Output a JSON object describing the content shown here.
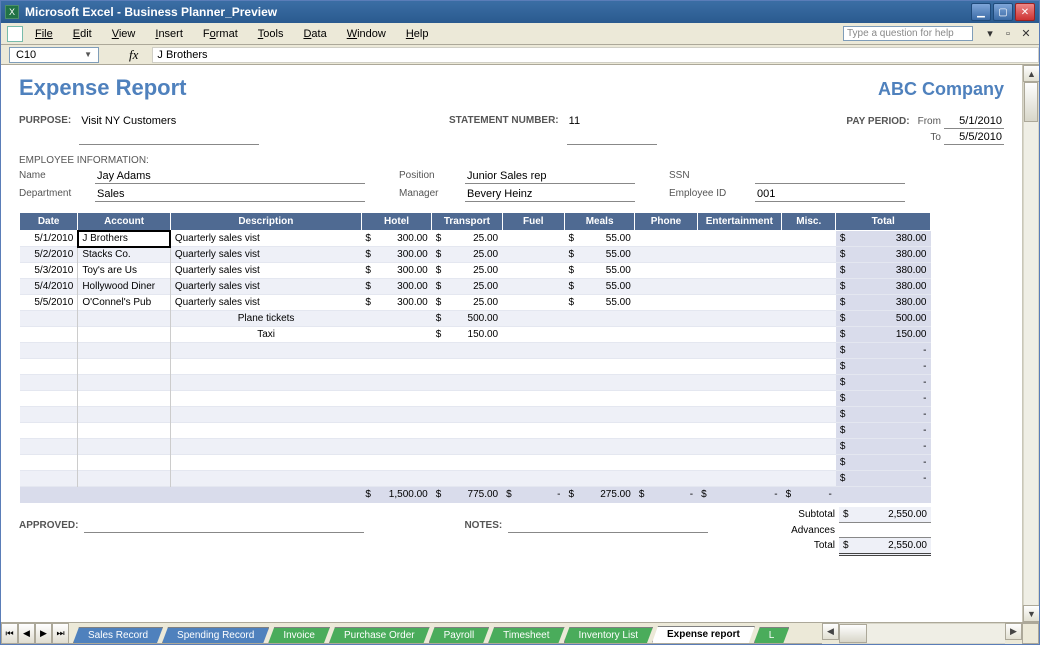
{
  "window": {
    "title": "Microsoft Excel - Business Planner_Preview",
    "help_placeholder": "Type a question for help"
  },
  "menu": {
    "file": "File",
    "edit": "Edit",
    "view": "View",
    "insert": "Insert",
    "format": "Format",
    "tools": "Tools",
    "data": "Data",
    "window": "Window",
    "help": "Help"
  },
  "formula_bar": {
    "cell": "C10",
    "value": "J Brothers"
  },
  "doc": {
    "title": "Expense Report",
    "company": "ABC Company",
    "purpose_label": "PURPOSE:",
    "purpose": "Visit NY Customers",
    "statement_label": "STATEMENT NUMBER:",
    "statement": "11",
    "pay_period_label": "PAY PERIOD:",
    "from_label": "From",
    "from": "5/1/2010",
    "to_label": "To",
    "to": "5/5/2010",
    "emp_info_label": "EMPLOYEE INFORMATION:",
    "name_label": "Name",
    "name": "Jay Adams",
    "department_label": "Department",
    "department": "Sales",
    "position_label": "Position",
    "position": "Junior Sales rep",
    "manager_label": "Manager",
    "manager": "Bevery Heinz",
    "ssn_label": "SSN",
    "ssn": "",
    "empid_label": "Employee ID",
    "empid": "001",
    "approved_label": "APPROVED:",
    "notes_label": "NOTES:"
  },
  "table": {
    "headers": [
      "Date",
      "Account",
      "Description",
      "Hotel",
      "Transport",
      "Fuel",
      "Meals",
      "Phone",
      "Entertainment",
      "Misc.",
      "Total"
    ],
    "rows": [
      {
        "date": "5/1/2010",
        "account": "J Brothers",
        "desc": "Quarterly sales vist",
        "hotel": "300.00",
        "transport": "25.00",
        "fuel": "",
        "meals": "55.00",
        "phone": "",
        "ent": "",
        "misc": "",
        "total": "380.00",
        "selected": true
      },
      {
        "date": "5/2/2010",
        "account": "Stacks Co.",
        "desc": "Quarterly sales vist",
        "hotel": "300.00",
        "transport": "25.00",
        "fuel": "",
        "meals": "55.00",
        "phone": "",
        "ent": "",
        "misc": "",
        "total": "380.00"
      },
      {
        "date": "5/3/2010",
        "account": "Toy's are Us",
        "desc": "Quarterly sales vist",
        "hotel": "300.00",
        "transport": "25.00",
        "fuel": "",
        "meals": "55.00",
        "phone": "",
        "ent": "",
        "misc": "",
        "total": "380.00"
      },
      {
        "date": "5/4/2010",
        "account": "Hollywood Diner",
        "desc": "Quarterly sales vist",
        "hotel": "300.00",
        "transport": "25.00",
        "fuel": "",
        "meals": "55.00",
        "phone": "",
        "ent": "",
        "misc": "",
        "total": "380.00"
      },
      {
        "date": "5/5/2010",
        "account": "O'Connel's Pub",
        "desc": "Quarterly sales vist",
        "hotel": "300.00",
        "transport": "25.00",
        "fuel": "",
        "meals": "55.00",
        "phone": "",
        "ent": "",
        "misc": "",
        "total": "380.00"
      },
      {
        "date": "",
        "account": "",
        "desc": "Plane tickets",
        "hotel": "",
        "transport": "500.00",
        "fuel": "",
        "meals": "",
        "phone": "",
        "ent": "",
        "misc": "",
        "total": "500.00"
      },
      {
        "date": "",
        "account": "",
        "desc": "Taxi",
        "hotel": "",
        "transport": "150.00",
        "fuel": "",
        "meals": "",
        "phone": "",
        "ent": "",
        "misc": "",
        "total": "150.00"
      },
      {
        "date": "",
        "account": "",
        "desc": "",
        "hotel": "",
        "transport": "",
        "fuel": "",
        "meals": "",
        "phone": "",
        "ent": "",
        "misc": "",
        "total": "-"
      },
      {
        "date": "",
        "account": "",
        "desc": "",
        "hotel": "",
        "transport": "",
        "fuel": "",
        "meals": "",
        "phone": "",
        "ent": "",
        "misc": "",
        "total": "-"
      },
      {
        "date": "",
        "account": "",
        "desc": "",
        "hotel": "",
        "transport": "",
        "fuel": "",
        "meals": "",
        "phone": "",
        "ent": "",
        "misc": "",
        "total": "-"
      },
      {
        "date": "",
        "account": "",
        "desc": "",
        "hotel": "",
        "transport": "",
        "fuel": "",
        "meals": "",
        "phone": "",
        "ent": "",
        "misc": "",
        "total": "-"
      },
      {
        "date": "",
        "account": "",
        "desc": "",
        "hotel": "",
        "transport": "",
        "fuel": "",
        "meals": "",
        "phone": "",
        "ent": "",
        "misc": "",
        "total": "-"
      },
      {
        "date": "",
        "account": "",
        "desc": "",
        "hotel": "",
        "transport": "",
        "fuel": "",
        "meals": "",
        "phone": "",
        "ent": "",
        "misc": "",
        "total": "-"
      },
      {
        "date": "",
        "account": "",
        "desc": "",
        "hotel": "",
        "transport": "",
        "fuel": "",
        "meals": "",
        "phone": "",
        "ent": "",
        "misc": "",
        "total": "-"
      },
      {
        "date": "",
        "account": "",
        "desc": "",
        "hotel": "",
        "transport": "",
        "fuel": "",
        "meals": "",
        "phone": "",
        "ent": "",
        "misc": "",
        "total": "-"
      },
      {
        "date": "",
        "account": "",
        "desc": "",
        "hotel": "",
        "transport": "",
        "fuel": "",
        "meals": "",
        "phone": "",
        "ent": "",
        "misc": "",
        "total": "-"
      }
    ],
    "totals": {
      "hotel": "1,500.00",
      "transport": "775.00",
      "fuel": "-",
      "meals": "275.00",
      "phone": "-",
      "ent": "-",
      "misc": "-",
      "total": ""
    }
  },
  "summary": {
    "subtotal_label": "Subtotal",
    "subtotal": "2,550.00",
    "advances_label": "Advances",
    "advances": "",
    "total_label": "Total",
    "total": "2,550.00"
  },
  "tabs": [
    {
      "label": "Sales Record",
      "color": "blue"
    },
    {
      "label": "Spending Record",
      "color": "blue"
    },
    {
      "label": "Invoice",
      "color": "green"
    },
    {
      "label": "Purchase Order",
      "color": "green"
    },
    {
      "label": "Payroll",
      "color": "green"
    },
    {
      "label": "Timesheet",
      "color": "green"
    },
    {
      "label": "Inventory List",
      "color": "green"
    },
    {
      "label": "Expense report",
      "color": "active"
    },
    {
      "label": "L",
      "color": "green"
    }
  ]
}
